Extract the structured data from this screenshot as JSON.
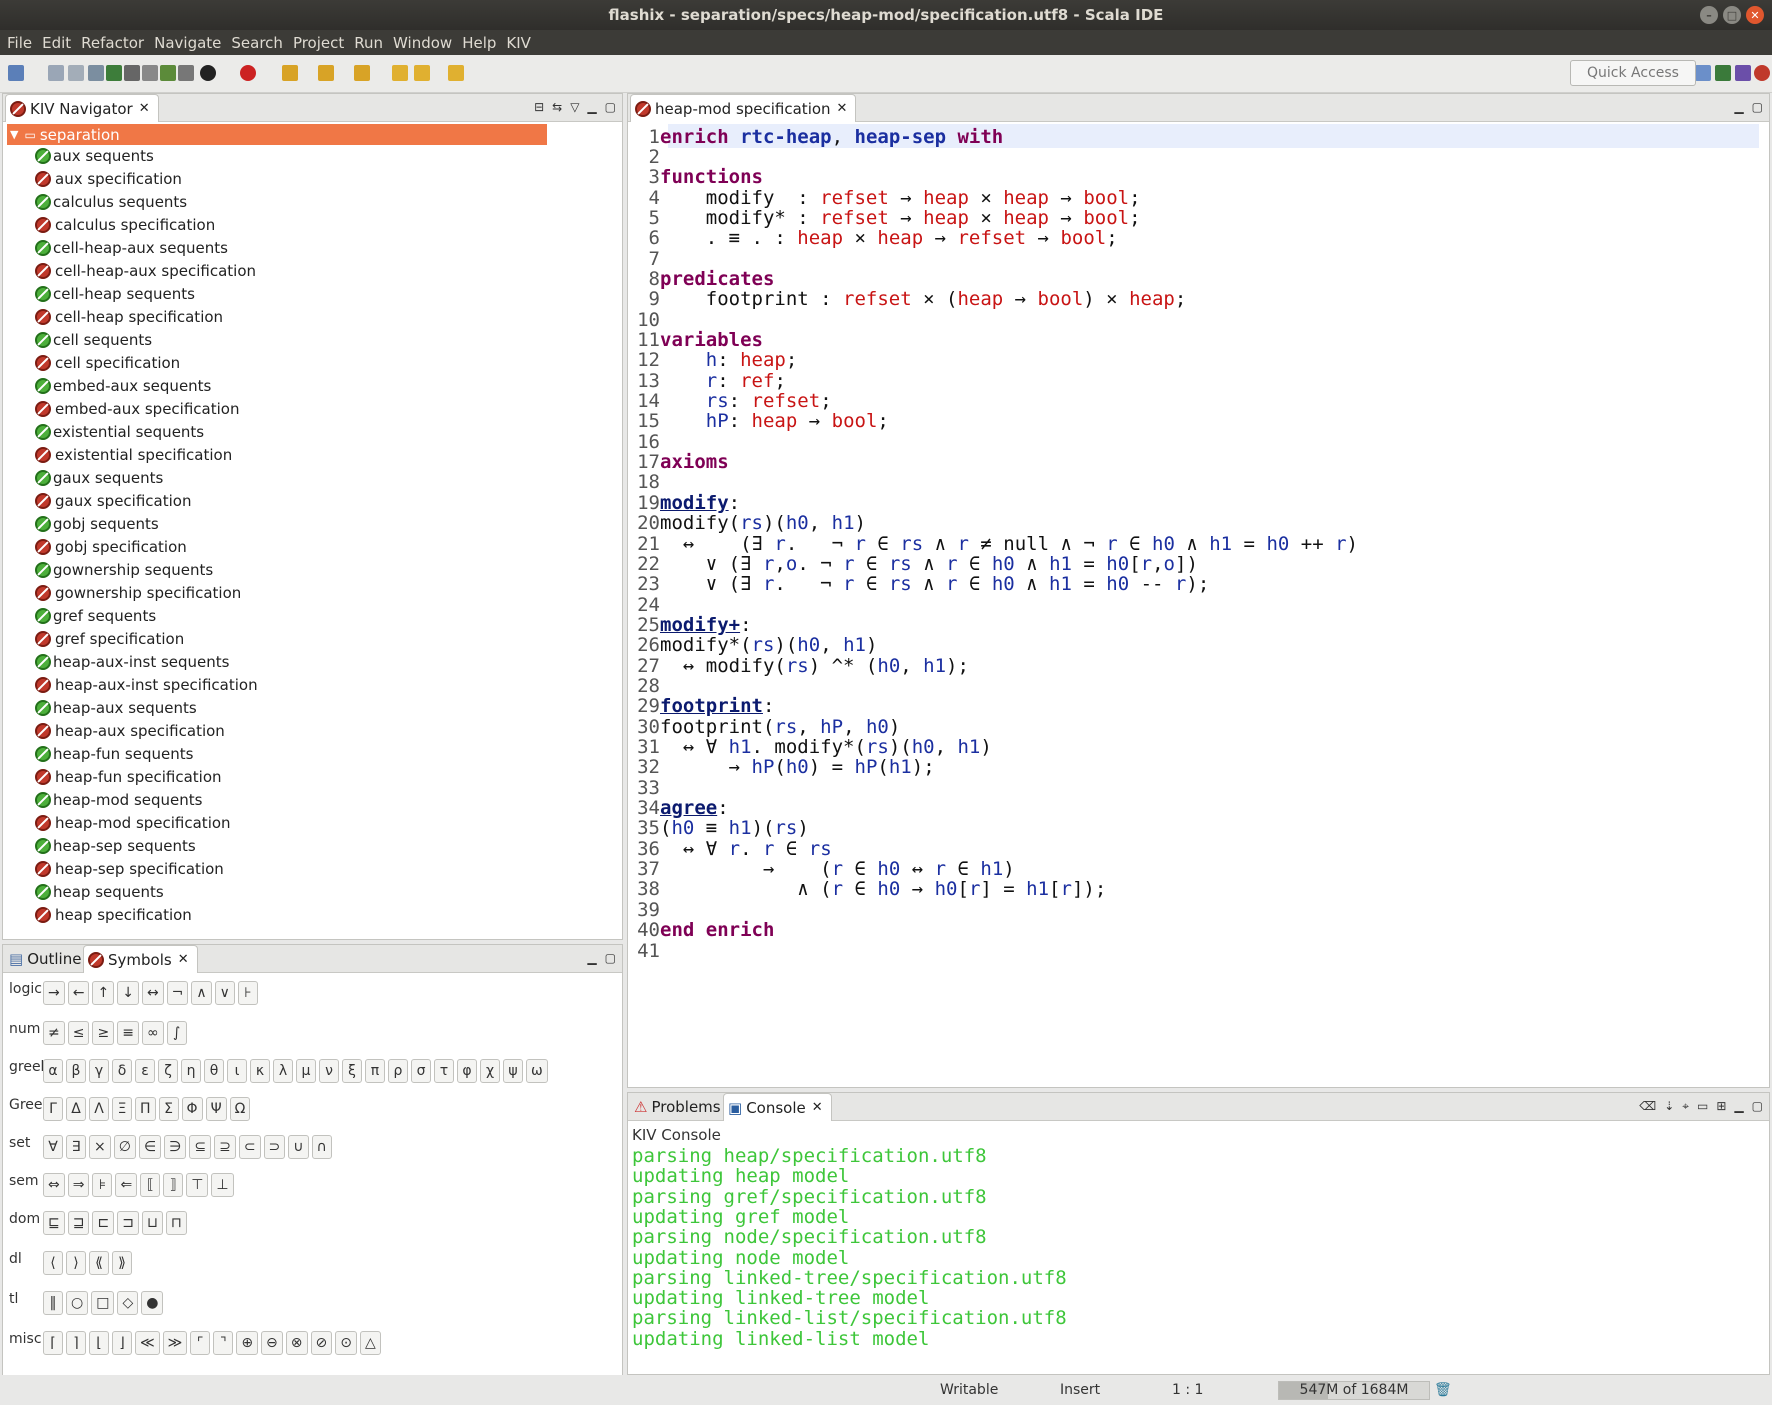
{
  "window": {
    "title": "flashix - separation/specs/heap-mod/specification.utf8 - Scala IDE"
  },
  "menu": [
    "File",
    "Edit",
    "Refactor",
    "Navigate",
    "Search",
    "Project",
    "Run",
    "Window",
    "Help",
    "KIV"
  ],
  "toolbar": {
    "quick_access": "Quick Access"
  },
  "navigator": {
    "tab_label": "KIV Navigator",
    "root": "separation",
    "items": [
      {
        "label": "aux sequents",
        "status": "ok"
      },
      {
        "label": "aux specification",
        "status": "kiv"
      },
      {
        "label": "calculus sequents",
        "status": "ok"
      },
      {
        "label": "calculus specification",
        "status": "kiv"
      },
      {
        "label": "cell-heap-aux sequents",
        "status": "ok"
      },
      {
        "label": "cell-heap-aux specification",
        "status": "kiv"
      },
      {
        "label": "cell-heap sequents",
        "status": "ok"
      },
      {
        "label": "cell-heap specification",
        "status": "kiv"
      },
      {
        "label": "cell sequents",
        "status": "ok"
      },
      {
        "label": "cell specification",
        "status": "kiv"
      },
      {
        "label": "embed-aux sequents",
        "status": "ok"
      },
      {
        "label": "embed-aux specification",
        "status": "kiv"
      },
      {
        "label": "existential sequents",
        "status": "ok"
      },
      {
        "label": "existential specification",
        "status": "kiv"
      },
      {
        "label": "gaux sequents",
        "status": "ok"
      },
      {
        "label": "gaux specification",
        "status": "kiv"
      },
      {
        "label": "gobj sequents",
        "status": "ok"
      },
      {
        "label": "gobj specification",
        "status": "kiv"
      },
      {
        "label": "gownership sequents",
        "status": "ok"
      },
      {
        "label": "gownership specification",
        "status": "kiv"
      },
      {
        "label": "gref sequents",
        "status": "ok"
      },
      {
        "label": "gref specification",
        "status": "kiv"
      },
      {
        "label": "heap-aux-inst sequents",
        "status": "ok"
      },
      {
        "label": "heap-aux-inst specification",
        "status": "kiv"
      },
      {
        "label": "heap-aux sequents",
        "status": "ok"
      },
      {
        "label": "heap-aux specification",
        "status": "kiv"
      },
      {
        "label": "heap-fun sequents",
        "status": "ok"
      },
      {
        "label": "heap-fun specification",
        "status": "kiv"
      },
      {
        "label": "heap-mod sequents",
        "status": "ok"
      },
      {
        "label": "heap-mod specification",
        "status": "kiv"
      },
      {
        "label": "heap-sep sequents",
        "status": "ok"
      },
      {
        "label": "heap-sep specification",
        "status": "kiv"
      },
      {
        "label": "heap sequents",
        "status": "ok"
      },
      {
        "label": "heap specification",
        "status": "kiv"
      }
    ]
  },
  "symbols_panel": {
    "tab_outline": "Outline",
    "tab_symbols": "Symbols",
    "rows": [
      {
        "label": "logic",
        "syms": [
          "→",
          "←",
          "↑",
          "↓",
          "↔",
          "¬",
          "∧",
          "∨",
          "⊦"
        ]
      },
      {
        "label": "num",
        "syms": [
          "≠",
          "≤",
          "≥",
          "≡",
          "∞",
          "∫"
        ]
      },
      {
        "label": "greek",
        "syms": [
          "α",
          "β",
          "γ",
          "δ",
          "ε",
          "ζ",
          "η",
          "θ",
          "ι",
          "κ",
          "λ",
          "μ",
          "ν",
          "ξ",
          "π",
          "ρ",
          "σ",
          "τ",
          "φ",
          "χ",
          "ψ",
          "ω"
        ]
      },
      {
        "label": "Greek",
        "syms": [
          "Γ",
          "Δ",
          "Λ",
          "Ξ",
          "Π",
          "Σ",
          "Φ",
          "Ψ",
          "Ω"
        ]
      },
      {
        "label": "set",
        "syms": [
          "∀",
          "∃",
          "×",
          "∅",
          "∈",
          "∋",
          "⊆",
          "⊇",
          "⊂",
          "⊃",
          "∪",
          "∩"
        ]
      },
      {
        "label": "sem",
        "syms": [
          "⇔",
          "⇒",
          "⊧",
          "⇐",
          "⟦",
          "⟧",
          "⊤",
          "⊥"
        ]
      },
      {
        "label": "dom",
        "syms": [
          "⊑",
          "⊒",
          "⊏",
          "⊐",
          "⊔",
          "⊓"
        ]
      },
      {
        "label": "dl",
        "syms": [
          "⟨",
          "⟩",
          "⟪",
          "⟫"
        ]
      },
      {
        "label": "tl",
        "syms": [
          "‖",
          "○",
          "□",
          "◇",
          "●"
        ]
      },
      {
        "label": "misc",
        "syms": [
          "⌈",
          "⌉",
          "⌊",
          "⌋",
          "≪",
          "≫",
          "⌜",
          "⌝",
          "⊕",
          "⊖",
          "⊗",
          "⊘",
          "⊙",
          "△"
        ]
      }
    ]
  },
  "editor": {
    "tab_label": "heap-mod specification",
    "lines": [
      "enrich rtc-heap, heap-sep with",
      "",
      "functions",
      "    modify  : refset → heap × heap → bool;",
      "    modify* : refset → heap × heap → bool;",
      "    . ≡ . : heap × heap → refset → bool;",
      "",
      "predicates",
      "    footprint : refset × (heap → bool) × heap;",
      "",
      "variables",
      "    h: heap;",
      "    r: ref;",
      "    rs: refset;",
      "    hP: heap → bool;",
      "",
      "axioms",
      "",
      "modify:",
      "modify(rs)(h0, h1)",
      "  ↔    (∃ r.   ¬ r ∈ rs ∧ r ≠ null ∧ ¬ r ∈ h0 ∧ h1 = h0 ++ r)",
      "    ∨ (∃ r,o. ¬ r ∈ rs ∧ r ∈ h0 ∧ h1 = h0[r,o])",
      "    ∨ (∃ r.   ¬ r ∈ rs ∧ r ∈ h0 ∧ h1 = h0 -- r);",
      "",
      "modify+:",
      "modify*(rs)(h0, h1)",
      "  ↔ modify(rs) ^* (h0, h1);",
      "",
      "footprint:",
      "footprint(rs, hP, h0)",
      "  ↔ ∀ h1. modify*(rs)(h0, h1)",
      "      → hP(h0) = hP(h1);",
      "",
      "agree:",
      "(h0 ≡ h1)(rs)",
      "  ↔ ∀ r. r ∈ rs",
      "         →    (r ∈ h0 ↔ r ∈ h1)",
      "            ∧ (r ∈ h0 → h0[r] = h1[r]);",
      "",
      "end enrich",
      ""
    ]
  },
  "console": {
    "tab_problems": "Problems",
    "tab_console": "Console",
    "title": "KIV Console",
    "lines": [
      "parsing heap/specification.utf8",
      "updating heap model",
      "parsing gref/specification.utf8",
      "updating gref model",
      "parsing node/specification.utf8",
      "updating node model",
      "parsing linked-tree/specification.utf8",
      "updating linked-tree model",
      "parsing linked-list/specification.utf8",
      "updating linked-list model"
    ]
  },
  "status": {
    "writable": "Writable",
    "insert": "Insert",
    "position": "1 : 1",
    "memory": "547M of 1684M",
    "memory_fraction": 0.325
  }
}
